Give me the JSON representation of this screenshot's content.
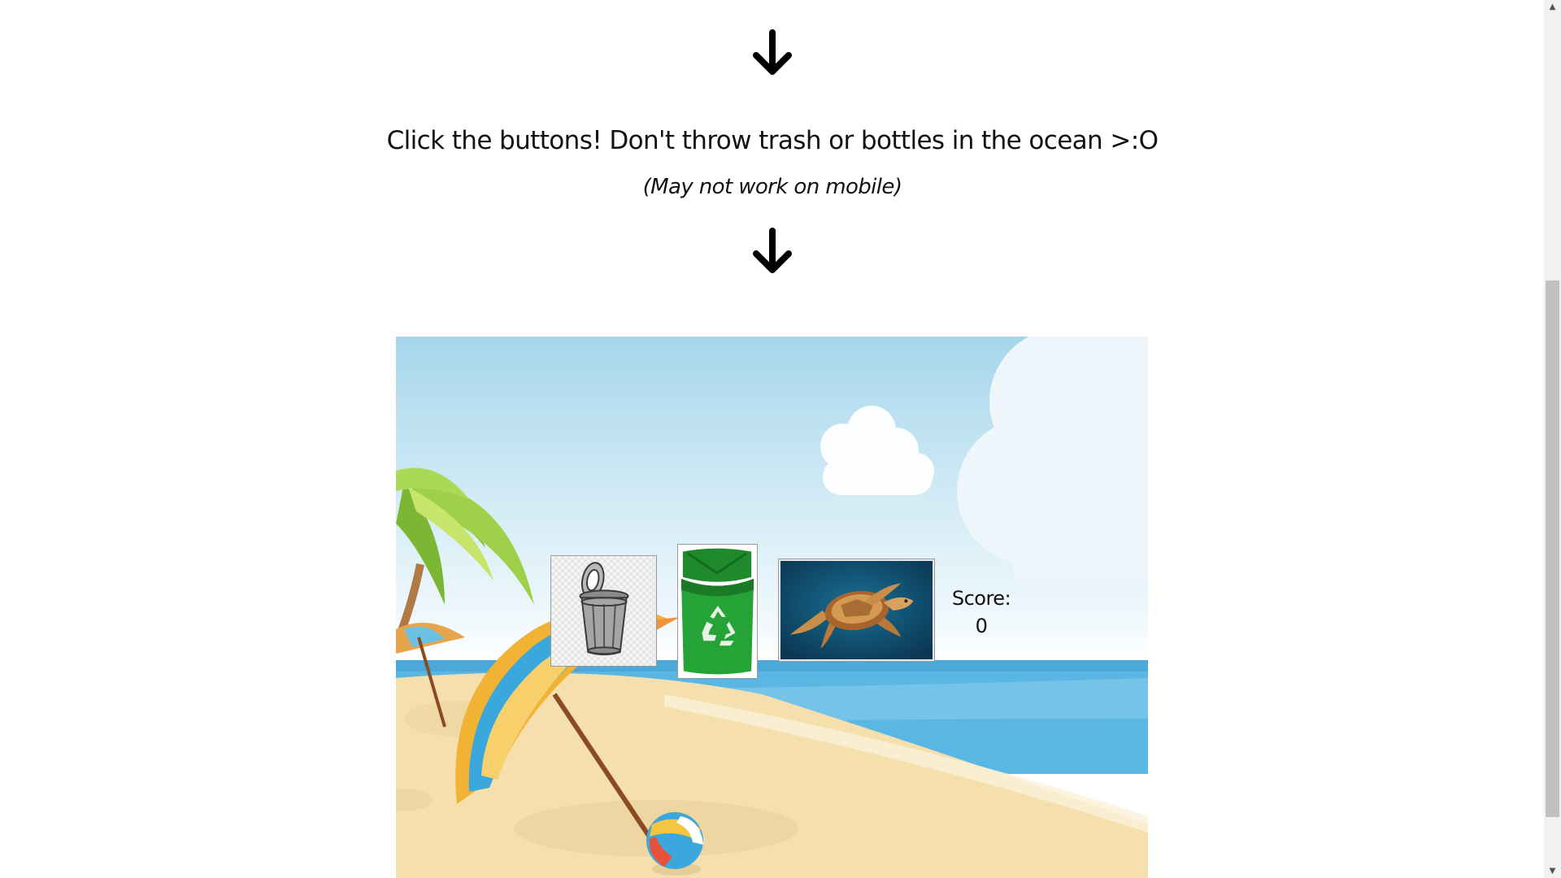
{
  "instructions": {
    "headline": "Click the buttons! Don't throw trash or bottles in the ocean >:O",
    "note": "(May not work on mobile)"
  },
  "icons": {
    "top_arrow": "arrow-down-icon",
    "bottom_arrow": "arrow-down-icon",
    "trash": "trash-can-icon",
    "recycle": "recycle-bin-icon",
    "turtle": "sea-turtle-image"
  },
  "game": {
    "score_label": "Score:",
    "score_value": "0"
  },
  "colors": {
    "sky_top": "#a6d6ec",
    "sea": "#5ab7e3",
    "sand": "#f4dfad",
    "recycle_green": "#1f8a2c",
    "ocean_photo": "#0e4a6e"
  },
  "scrollbar": {
    "up_glyph": "▲",
    "down_glyph": "▼"
  }
}
